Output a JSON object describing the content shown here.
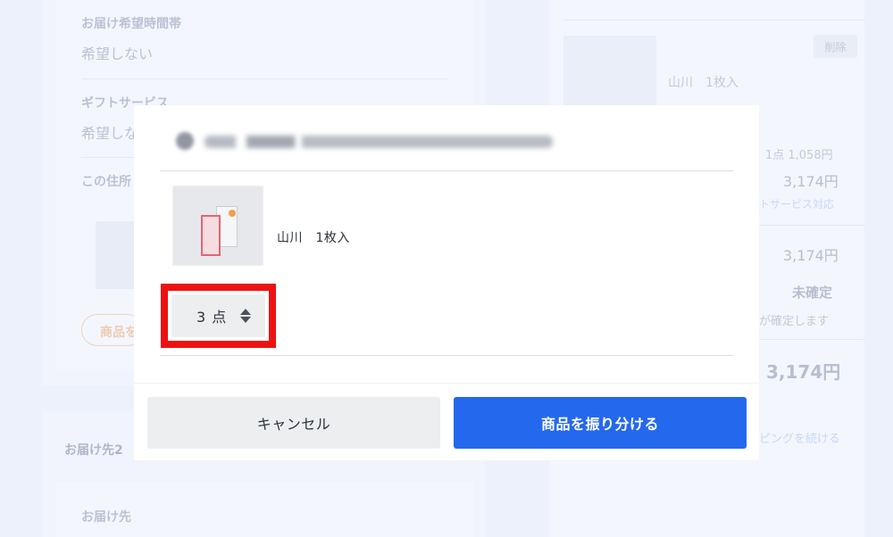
{
  "background": {
    "left_card": {
      "fields": [
        {
          "label": "お届け希望時間帯",
          "value": "希望しない"
        },
        {
          "label": "ギフトサービス",
          "value": "希望しな"
        },
        {
          "label": "この住所",
          "value": ""
        }
      ],
      "pill_label": "商品を"
    },
    "second_card": {
      "title": "お届け先2",
      "field_label": "お届け先"
    },
    "right_card": {
      "delete_label": "削除",
      "product_name": "山川　1枚入",
      "unit_price": "1点 1,058円",
      "line_total": "3,174円",
      "gift_note": "トサービス対応",
      "subtotal": "3,174円",
      "shipping_status": "未確定",
      "shipping_note": "が確定します",
      "grand_total": "3,174円",
      "continue_link": "ピングを続ける"
    }
  },
  "modal": {
    "product": {
      "name": "山川　1枚入"
    },
    "quantity": {
      "value": "3 点"
    },
    "buttons": {
      "cancel": "キャンセル",
      "submit": "商品を振り分ける"
    }
  },
  "colors": {
    "primary": "#2468ee",
    "highlight": "#ee1111",
    "backdrop": "#eef2fb"
  },
  "icons": [
    "chevron-up-down-icon",
    "cart-icon"
  ]
}
